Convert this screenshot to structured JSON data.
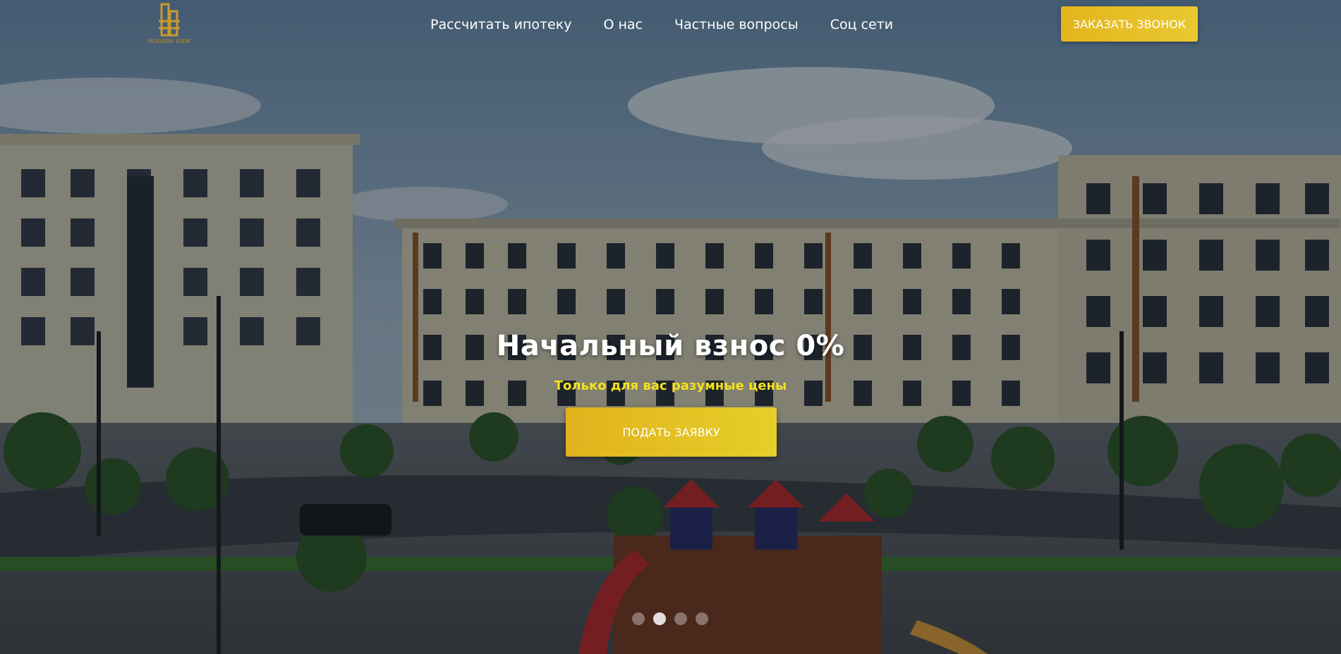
{
  "header": {
    "logo_text": "MODERN VIEW",
    "nav": [
      {
        "label": "Рассчитать ипотеку"
      },
      {
        "label": "О нас"
      },
      {
        "label": "Частные вопросы"
      },
      {
        "label": "Соц сети"
      }
    ],
    "call_button": "ЗАКАЗАТЬ ЗВОНОК"
  },
  "hero": {
    "title": "Начальный взнос 0%",
    "subtitle": "Только для вас разумные цены",
    "apply_button": "ПОДАТЬ ЗАЯВКУ"
  },
  "slider": {
    "dot_count": 4,
    "active_index": 1
  },
  "colors": {
    "accent": "#e3b51e",
    "subtitle": "#f5e21b",
    "logo": "#c99a2e"
  },
  "icons": {
    "logo": "building-logo-icon"
  }
}
